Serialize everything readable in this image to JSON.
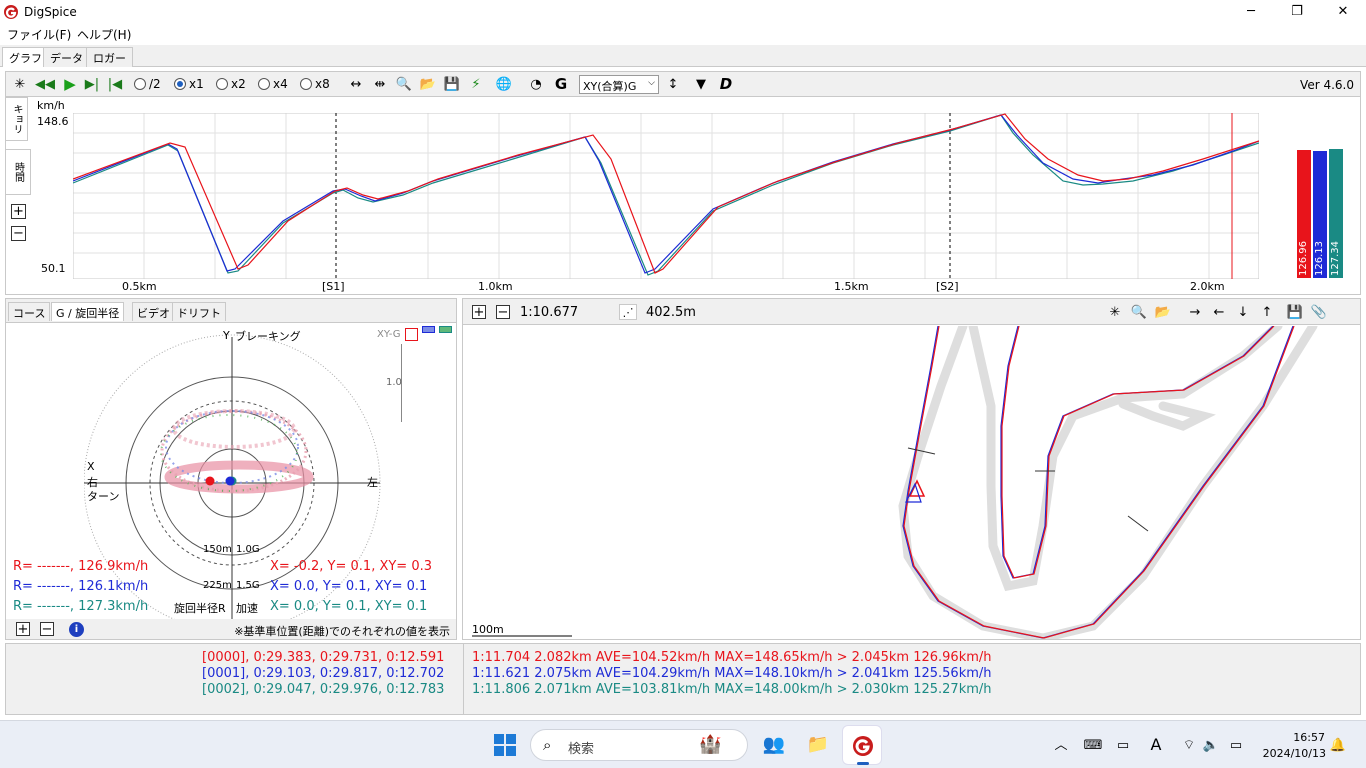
{
  "window": {
    "title": "DigSpice",
    "minimize": "─",
    "maximize": "❐",
    "close": "✕"
  },
  "menu": [
    "ファイル(F)",
    "ヘルプ(H)"
  ],
  "tabs": [
    "グラフ",
    "データ",
    "ロガー"
  ],
  "toolbar": {
    "speeds": [
      {
        "label": "/2",
        "selected": false
      },
      {
        "label": "x1",
        "selected": true
      },
      {
        "label": "x2",
        "selected": false
      },
      {
        "label": "x4",
        "selected": false
      },
      {
        "label": "x8",
        "selected": false
      }
    ],
    "g_label": "G",
    "xy_select": "XY(合算)G",
    "d_label": "D",
    "version": "Ver 4.6.0"
  },
  "graph": {
    "unit": "km/h",
    "ymax": "148.6",
    "ymin": "50.1",
    "side_tabs": [
      "キョリ",
      "時間"
    ],
    "xticks": [
      "0.5km",
      "1.0km",
      "1.5km",
      "2.0km"
    ],
    "sectors": [
      "[S1]",
      "[S2]"
    ],
    "bars": [
      {
        "value": "126.96",
        "color": "#e8141b"
      },
      {
        "value": "126.13",
        "color": "#1e2bd6"
      },
      {
        "value": "127.34",
        "color": "#1a8a84"
      }
    ],
    "colors": {
      "red": "#e8141b",
      "blue": "#1e2bd6",
      "teal": "#1a8a84"
    }
  },
  "left": {
    "tabs": [
      "コース",
      "G / 旋回半径",
      "ビデオ",
      "ドリフト"
    ],
    "labels": {
      "y": "Y",
      "braking": "ブレーキング",
      "x": "X",
      "right": "右",
      "turn": "ターン",
      "left_side": "左",
      "xy_g": "XY-G",
      "scale": "1.0",
      "r150": "150m",
      "g10": "1.0G",
      "r225": "225m",
      "g15": "1.5G",
      "radius": "旋回半径R",
      "accel": "加速"
    },
    "readouts": [
      {
        "r": "R= -------, 126.9km/h",
        "xy": "X= -0.2, Y=  0.1, XY= 0.3",
        "color": "#e8141b"
      },
      {
        "r": "R= -------, 126.1km/h",
        "xy": "X=  0.0, Y=  0.1, XY= 0.1",
        "color": "#1e2bd6"
      },
      {
        "r": "R= -------, 127.3km/h",
        "xy": "X=  0.0, Y=  0.1, XY= 0.1",
        "color": "#1a8a84"
      }
    ],
    "note": "※基準車位置(距離)でのそれぞれの値を表示"
  },
  "map": {
    "lap_time": "1:10.677",
    "distance": "402.5m",
    "scale": "100m"
  },
  "bottom": {
    "left": [
      {
        "text": "[0000], 0:29.383, 0:29.731, 0:12.591",
        "color": "#e8141b"
      },
      {
        "text": "[0001], 0:29.103, 0:29.817, 0:12.702",
        "color": "#1e2bd6"
      },
      {
        "text": "[0002], 0:29.047, 0:29.976, 0:12.783",
        "color": "#1a8a84"
      }
    ],
    "right": [
      {
        "text": "1:11.704 2.082km AVE=104.52km/h MAX=148.65km/h > 2.045km 126.96km/h",
        "color": "#e8141b"
      },
      {
        "text": "1:11.621 2.075km AVE=104.29km/h MAX=148.10km/h > 2.041km 125.56km/h",
        "color": "#1e2bd6"
      },
      {
        "text": "1:11.806 2.071km AVE=103.81km/h MAX=148.00km/h > 2.030km 125.27km/h",
        "color": "#1a8a84"
      }
    ]
  },
  "taskbar": {
    "search": "検索",
    "time": "16:57",
    "date": "2024/10/13"
  }
}
